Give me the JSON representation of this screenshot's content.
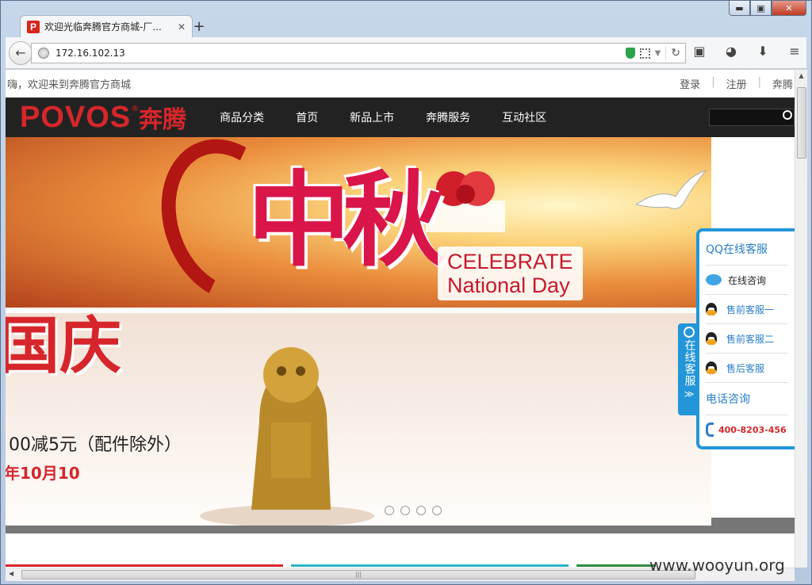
{
  "window": {
    "controls": {
      "minimize": "▬",
      "maximize": "▣",
      "close": "✕"
    }
  },
  "browser": {
    "tab": {
      "title": "欢迎光临奔腾官方商城-厂...",
      "favicon_letter": "P",
      "close": "✕"
    },
    "new_tab": "+",
    "url": "172.16.102.13",
    "icons": [
      "back-arrow-icon",
      "globe-icon",
      "shield-icon",
      "qr-code-icon",
      "dropdown-icon",
      "reload-icon",
      "reader-icon",
      "palette-icon",
      "download-icon",
      "menu-icon"
    ]
  },
  "site": {
    "topbar": {
      "welcome": "嗨，欢迎来到奔腾官方商城",
      "links": [
        "登录",
        "注册",
        "奔腾"
      ]
    },
    "logo": {
      "en": "POVOS",
      "reg": "®",
      "cn": "奔腾"
    },
    "nav": [
      "商品分类",
      "首页",
      "新品上市",
      "奔腾服务",
      "互动社区"
    ],
    "banner": {
      "big_cn": "中秋",
      "celebrate_line1": "CELEBRATE",
      "celebrate_line2": "National Day",
      "guoqing": "国庆",
      "promo1": "00减5元（配件除外）",
      "promo2": "年10月10",
      "dots": 4
    },
    "customer_service": {
      "tab_label": "在线客服",
      "tab_chevron": "≫",
      "title": "QQ在线客服",
      "items": [
        "在线咨询",
        "售前客服一",
        "售前客服二",
        "售后客服"
      ],
      "phone_title": "电话咨询",
      "phone": "400-8203-456"
    }
  },
  "watermark": "www.wooyun.org",
  "colors": {
    "brand_red": "#d7262b",
    "cs_blue": "#2296d8",
    "header_bg": "#222222"
  }
}
